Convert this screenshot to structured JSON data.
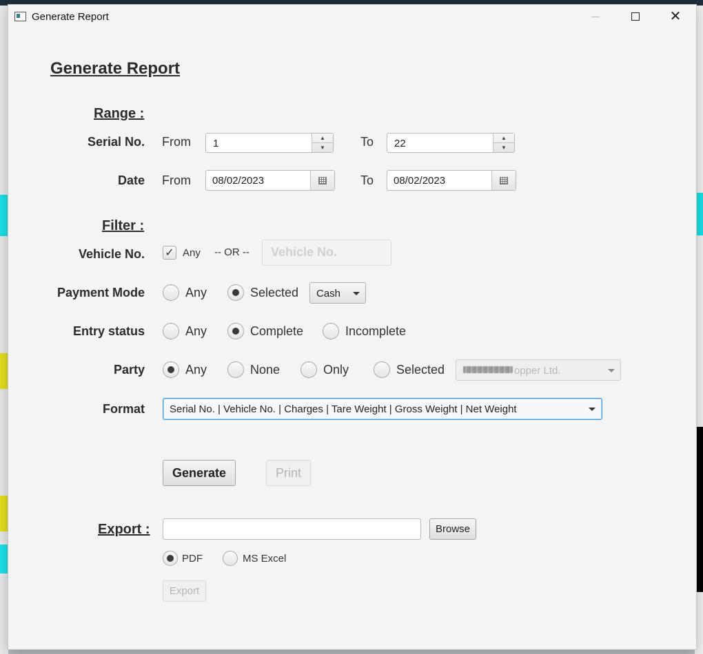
{
  "window": {
    "title": "Generate Report"
  },
  "heading": "Generate Report",
  "range": {
    "title": "Range :",
    "serial": {
      "label": "Serial No.",
      "from_label": "From",
      "from_value": "1",
      "to_label": "To",
      "to_value": "22"
    },
    "date": {
      "label": "Date",
      "from_label": "From",
      "from_value": "08/02/2023",
      "to_label": "To",
      "to_value": "08/02/2023"
    }
  },
  "filter": {
    "title": "Filter :",
    "vehicle": {
      "label": "Vehicle No.",
      "any_label": "Any",
      "any_checked": true,
      "or_label": "-- OR --",
      "placeholder": "Vehicle No."
    },
    "payment": {
      "label": "Payment Mode",
      "any_label": "Any",
      "selected_label": "Selected",
      "selected_option": "selected",
      "mode_value": "Cash"
    },
    "entry": {
      "label": "Entry status",
      "any_label": "Any",
      "complete_label": "Complete",
      "incomplete_label": "Incomplete",
      "selected_option": "complete"
    },
    "party": {
      "label": "Party",
      "any_label": "Any",
      "none_label": "None",
      "only_label": "Only",
      "selected_label": "Selected",
      "selected_option": "any",
      "party_value": "opper Ltd."
    },
    "format": {
      "label": "Format",
      "value": "Serial No. | Vehicle No. | Charges | Tare Weight | Gross Weight | Net Weight"
    }
  },
  "actions": {
    "generate_label": "Generate",
    "print_label": "Print"
  },
  "export": {
    "title": "Export :",
    "path_value": "",
    "browse_label": "Browse",
    "pdf_label": "PDF",
    "excel_label": "MS Excel",
    "selected_format": "pdf",
    "export_label": "Export"
  },
  "colors": {
    "accent": "#3a9ad9",
    "bg_cyan": "#19e3e8",
    "bg_yellow": "#e6df1d",
    "bg_orange": "#e89a1b"
  }
}
